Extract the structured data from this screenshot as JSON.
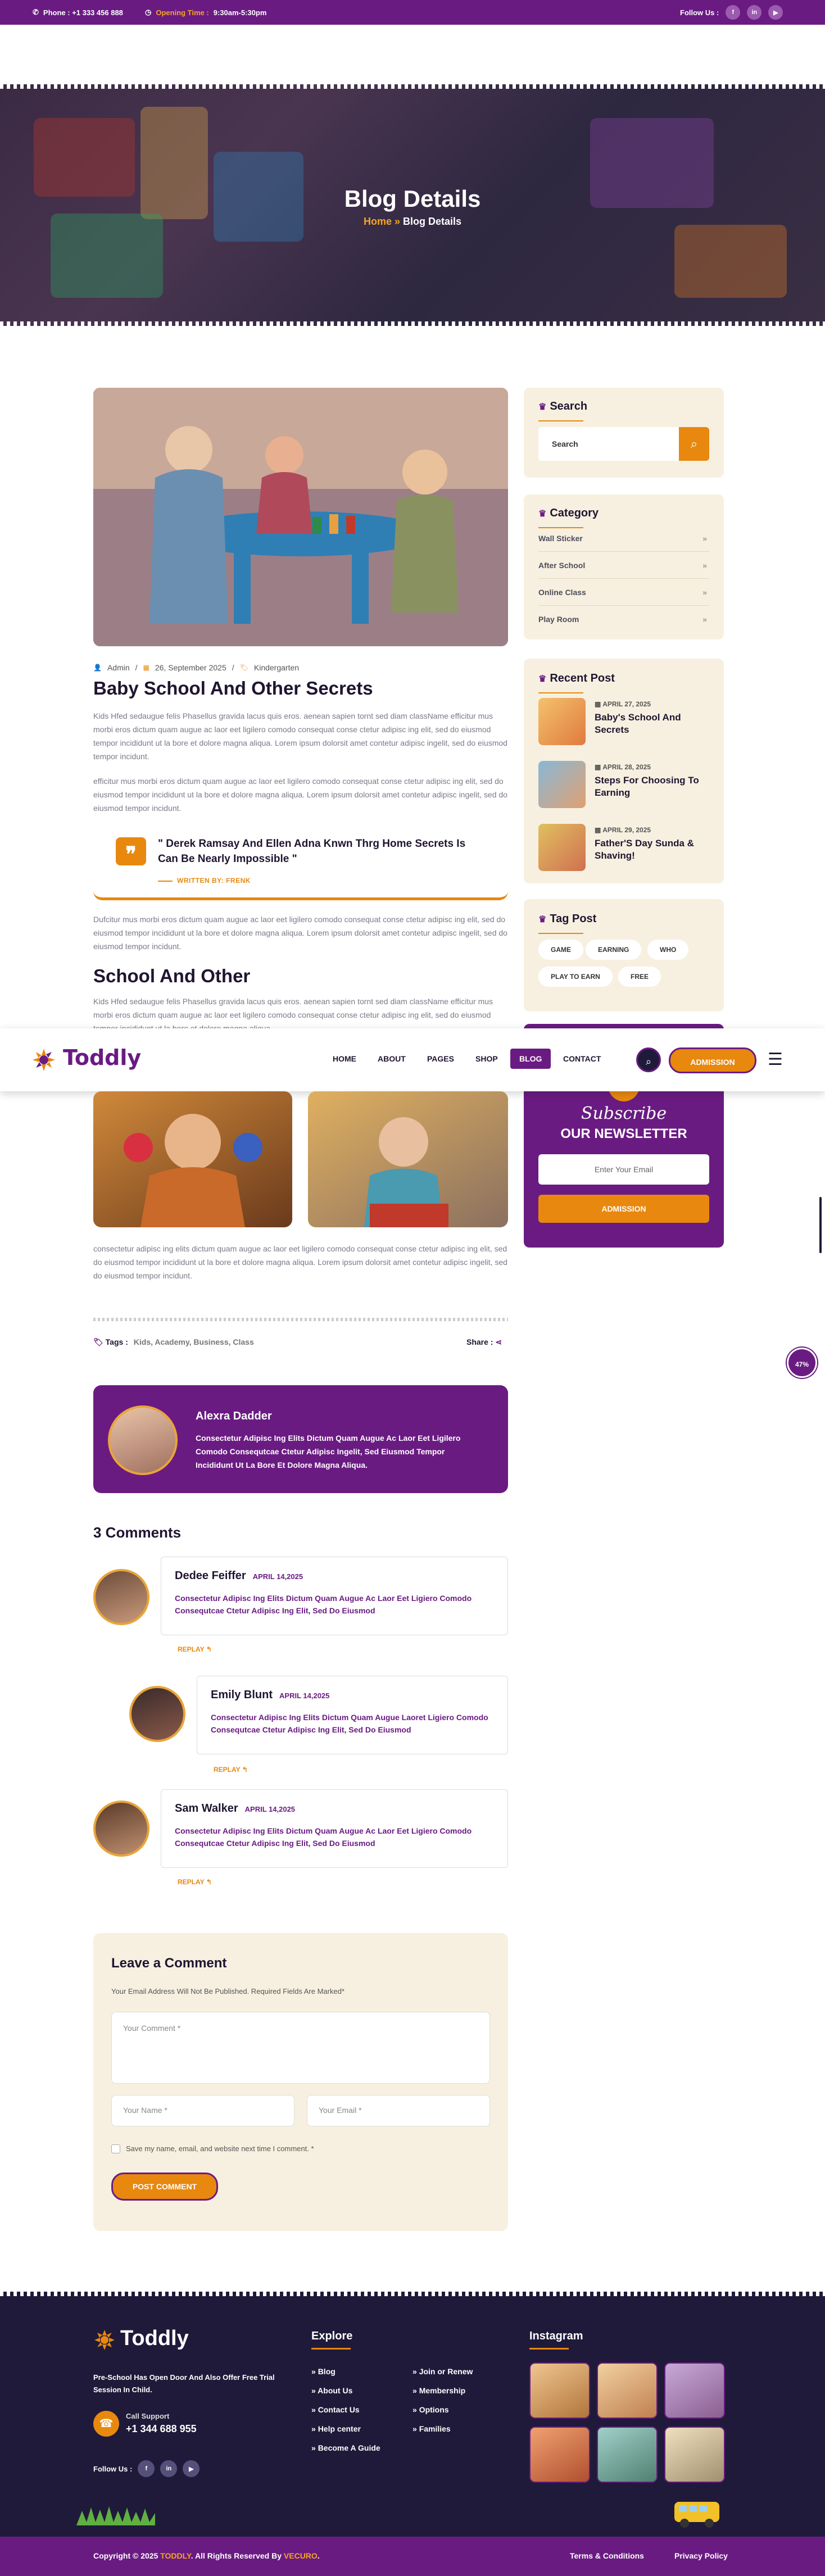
{
  "topbar": {
    "phone": "Phone : +1 333 456 888",
    "opening_label": "Opening Time :",
    "opening_value": "9:30am-5:30pm",
    "follow": "Follow Us :",
    "social": [
      "f",
      "in",
      "▶"
    ]
  },
  "hero": {
    "title": "Blog Details",
    "home": "Home",
    "sep": "»",
    "current": "Blog Details"
  },
  "post": {
    "meta_author": "Admin",
    "meta_date": "26, September 2025",
    "meta_cat": "Kindergarten",
    "title": "Baby School And Other Secrets",
    "p1": "Kids Hfed sedaugue felis Phasellus gravida lacus quis eros. aenean sapien tornt sed diam className efficitur mus morbi eros dictum quam augue ac laor eet ligilero comodo consequat conse ctetur adipisc ing elit, sed do eiusmod tempor incididunt ut la bore et dolore magna aliqua. Lorem ipsum dolorsit amet contetur adipisc ingelit, sed do eiusmod tempor incidunt.",
    "p2": "efficitur mus morbi eros dictum quam augue ac laor eet ligilero comodo consequat conse ctetur adipisc ing elit, sed do eiusmod tempor incididunt ut la bore et dolore magna aliqua. Lorem ipsum dolorsit amet contetur adipisc ingelit, sed do eiusmod tempor incidunt.",
    "quote": "\" Derek Ramsay And Ellen Adna Knwn Thrg Home Secrets Is Can Be Nearly Impossible \"",
    "quote_author": "WRITTEN BY: FRENK",
    "p3": "Dufcitur mus morbi eros dictum quam augue ac laor eet ligilero comodo consequat conse ctetur adipisc ing elit, sed do eiusmod tempor incididunt ut la bore et dolore magna aliqua. Lorem ipsum dolorsit amet contetur adipisc ingelit, sed do eiusmod tempor incidunt.",
    "subtitle": "School And Other",
    "p4": "Kids Hfed sedaugue felis Phasellus gravida lacus quis eros. aenean sapien tornt sed diam className efficitur mus morbi eros dictum quam augue ac laor eet ligilero comodo consequat conse ctetur adipisc ing elit, sed do eiusmod tempor incididunt ut la bore et dolore magna aliqua.",
    "p5": "consectetur adipisc ing elits dictum quam augue ac laor eet ligilero comodo consequat conse ctetur adipisc ing elit, sed do eiusmod tempor incididunt ut la bore et dolore magna aliqua. Lorem ipsum dolorsit amet contetur adipisc ingelit, sed do eiusmod tempor incidunt.",
    "tags_label": "Tags :",
    "tags": "Kids, Academy, Business, Class",
    "share_label": "Share :"
  },
  "sidebar": {
    "search_title": "Search",
    "search_placeholder": "Search",
    "category_title": "Category",
    "categories": [
      "Wall Sticker",
      "After School",
      "Online Class",
      "Play Room"
    ],
    "recent_title": "Recent Post",
    "recent": [
      {
        "date": "APRIL 27, 2025",
        "title": "Baby's School And Secrets"
      },
      {
        "date": "APRIL 28, 2025",
        "title": "Steps For Choosing To Earning"
      },
      {
        "date": "APRIL 29, 2025",
        "title": "Father'S Day Sunda & Shaving!"
      }
    ],
    "tag_title": "Tag Post",
    "tags": [
      "GAME",
      "EARNING",
      "WHO",
      "PLAY TO EARN",
      "FREE"
    ],
    "newsletter_title": "Subscribe",
    "newsletter_sub": "OUR NEWSLETTER",
    "newsletter_placeholder": "Enter Your Email",
    "newsletter_button": "ADMISSION"
  },
  "nav": {
    "logo": "Toddly",
    "links": [
      "HOME",
      "ABOUT",
      "PAGES",
      "SHOP",
      "BLOG",
      "CONTACT"
    ],
    "admission": "ADMISSION"
  },
  "author": {
    "name": "Alexra Dadder",
    "bio": "Consectetur Adipisc Ing Elits Dictum Quam Augue Ac Laor Eet Ligilero Comodo Consequtcae Ctetur Adipisc Ingelit, Sed Eiusmod Tempor Incididunt Ut La Bore Et Dolore Magna Aliqua."
  },
  "comments": {
    "title": "3 Comments",
    "items": [
      {
        "name": "Dedee Feiffer",
        "date": "APRIL 14,2025",
        "text": "Consectetur Adipisc Ing Elits Dictum Quam Augue Ac Laor Eet Ligiero Comodo Consequtcae Ctetur Adipisc Ing Elit, Sed Do Eiusmod",
        "reply": "REPLAY ↰"
      },
      {
        "name": "Emily Blunt",
        "date": "APRIL 14,2025",
        "text": "Consectetur Adipisc Ing Elits Dictum Quam Augue Laoret Ligiero Comodo Consequtcae Ctetur Adipisc Ing Elit, Sed Do Eiusmod",
        "reply": "REPLAY ↰"
      },
      {
        "name": "Sam Walker",
        "date": "APRIL 14,2025",
        "text": "Consectetur Adipisc Ing Elits Dictum Quam Augue Ac Laor Eet Ligiero Comodo Consequtcae Ctetur Adipisc Ing Elit, Sed Do Eiusmod",
        "reply": "REPLAY ↰"
      }
    ]
  },
  "leave": {
    "title": "Leave a Comment",
    "note": "Your Email Address Will Not Be Published. Required Fields Are Marked*",
    "comment_ph": "Your Comment *",
    "name_ph": "Your Name *",
    "email_ph": "Your Email *",
    "save": "Save my name, email, and website next time I comment. *",
    "button": "POST COMMENT"
  },
  "progress_badge": "47%",
  "footer": {
    "logo": "Toddly",
    "about": "Pre-School Has Open Door And Also Offer Free Trial Session In Child.",
    "call_label": "Call Support",
    "call_number": "+1 344 688 955",
    "follow": "Follow Us :",
    "explore_title": "Explore",
    "explore_col1": [
      "Blog",
      "About Us",
      "Contact Us",
      "Help center",
      "Become A Guide"
    ],
    "explore_col2": [
      "Join or Renew",
      "Membership",
      "Options",
      "Families"
    ],
    "instagram_title": "Instagram",
    "copyright_pre": "Copyright © 2025",
    "copyright_brand": "TODDLY",
    "copyright_mid": ". All Rights Reserved By",
    "copyright_by": "VECURO",
    "copyright_end": ".",
    "terms": "Terms & Conditions",
    "privacy": "Privacy Policy"
  }
}
